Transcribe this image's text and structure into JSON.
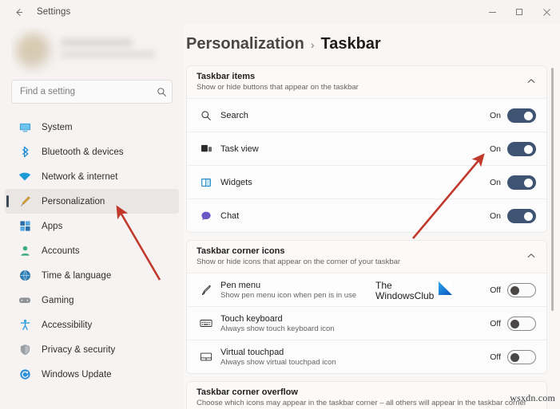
{
  "window": {
    "title": "Settings",
    "back_icon": "back-arrow-icon",
    "controls": {
      "minimize": "–",
      "maximize": "□",
      "close": "✕"
    }
  },
  "sidebar": {
    "search": {
      "placeholder": "Find a setting",
      "icon": "search-icon"
    },
    "items": [
      {
        "label": "System",
        "icon": "monitor-icon",
        "active": false
      },
      {
        "label": "Bluetooth & devices",
        "icon": "bluetooth-icon",
        "active": false
      },
      {
        "label": "Network & internet",
        "icon": "wifi-icon",
        "active": false
      },
      {
        "label": "Personalization",
        "icon": "paintbrush-icon",
        "active": true
      },
      {
        "label": "Apps",
        "icon": "apps-icon",
        "active": false
      },
      {
        "label": "Accounts",
        "icon": "account-icon",
        "active": false
      },
      {
        "label": "Time & language",
        "icon": "clock-globe-icon",
        "active": false
      },
      {
        "label": "Gaming",
        "icon": "gamepad-icon",
        "active": false
      },
      {
        "label": "Accessibility",
        "icon": "accessibility-icon",
        "active": false
      },
      {
        "label": "Privacy & security",
        "icon": "shield-icon",
        "active": false
      },
      {
        "label": "Windows Update",
        "icon": "update-icon",
        "active": false
      }
    ]
  },
  "breadcrumb": {
    "parent": "Personalization",
    "separator": "›",
    "current": "Taskbar"
  },
  "sections": [
    {
      "title": "Taskbar items",
      "subtitle": "Show or hide buttons that appear on the taskbar",
      "chevron": "chevron-up-icon",
      "rows": [
        {
          "title": "Search",
          "subtitle": "",
          "icon": "search-icon",
          "state": "On",
          "on": true
        },
        {
          "title": "Task view",
          "subtitle": "",
          "icon": "task-view-icon",
          "state": "On",
          "on": true
        },
        {
          "title": "Widgets",
          "subtitle": "",
          "icon": "widgets-icon",
          "state": "On",
          "on": true
        },
        {
          "title": "Chat",
          "subtitle": "",
          "icon": "chat-icon",
          "state": "On",
          "on": true
        }
      ]
    },
    {
      "title": "Taskbar corner icons",
      "subtitle": "Show or hide icons that appear on the corner of your taskbar",
      "chevron": "chevron-up-icon",
      "rows": [
        {
          "title": "Pen menu",
          "subtitle": "Show pen menu icon when pen is in use",
          "icon": "pen-icon",
          "state": "Off",
          "on": false
        },
        {
          "title": "Touch keyboard",
          "subtitle": "Always show touch keyboard icon",
          "icon": "keyboard-icon",
          "state": "Off",
          "on": false
        },
        {
          "title": "Virtual touchpad",
          "subtitle": "Always show virtual touchpad icon",
          "icon": "touchpad-icon",
          "state": "Off",
          "on": false
        }
      ]
    },
    {
      "title": "Taskbar corner overflow",
      "subtitle": "Choose which icons may appear in the taskbar corner – all others will appear in the taskbar corner",
      "chevron": "chevron-up-icon",
      "rows": []
    }
  ],
  "watermark": {
    "line1": "The",
    "line2": "WindowsClub",
    "logo": "windowsclub-logo-icon",
    "corner": "wsxdn.com"
  },
  "colors": {
    "accent": "#3f5472",
    "sidebar_bg": "#f6f3f2",
    "main_bg": "#f9f7f6",
    "card_bg": "#fdfcfc",
    "annotation_red": "#c0392b"
  }
}
